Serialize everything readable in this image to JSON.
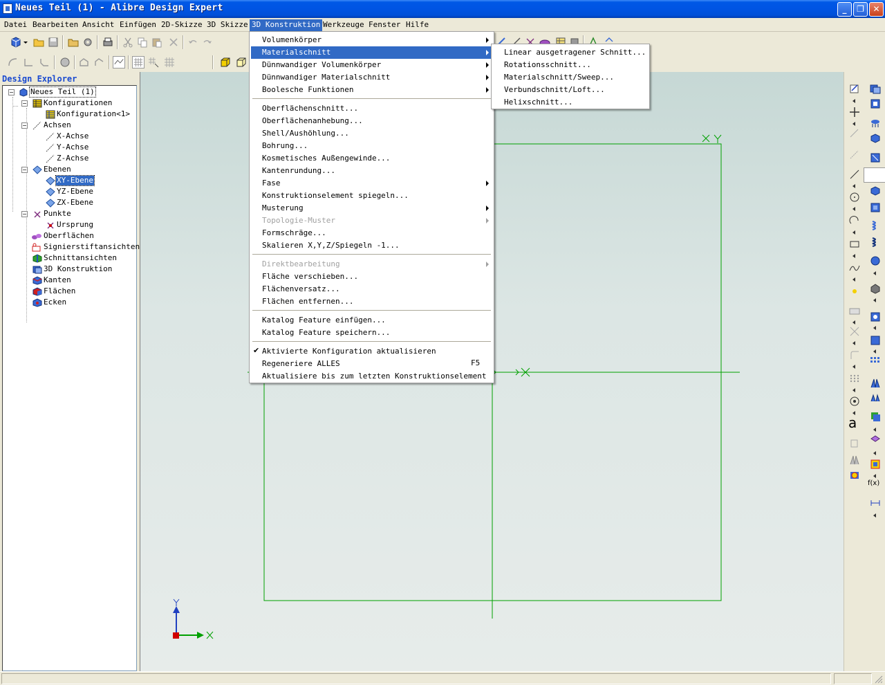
{
  "window": {
    "title": "Neues Teil (1) - Alibre Design Expert",
    "minimize_glyph": "_",
    "maximize_glyph": "❐",
    "close_glyph": "✕"
  },
  "menubar": {
    "items": [
      {
        "label": "Datei"
      },
      {
        "label": "Bearbeiten"
      },
      {
        "label": "Ansicht"
      },
      {
        "label": "Einfügen"
      },
      {
        "label": "2D-Skizze"
      },
      {
        "label": "3D Skizze"
      },
      {
        "label": "3D Konstruktion",
        "active": true
      },
      {
        "label": "Werkzeuge"
      },
      {
        "label": "Fenster"
      },
      {
        "label": "Hilfe"
      }
    ]
  },
  "explorer": {
    "title": "Design Explorer",
    "tree": [
      {
        "label": "Neues Teil (1)",
        "icon": "part-icon"
      },
      {
        "label": "Konfigurationen",
        "icon": "configurations-icon"
      },
      {
        "label": "Konfiguration<1>",
        "icon": "configuration-table-icon"
      },
      {
        "label": "Achsen",
        "icon": "axes-icon"
      },
      {
        "label": "X-Achse",
        "icon": "axis-icon"
      },
      {
        "label": "Y-Achse",
        "icon": "axis-icon"
      },
      {
        "label": "Z-Achse",
        "icon": "axis-icon"
      },
      {
        "label": "Ebenen",
        "icon": "planes-icon"
      },
      {
        "label": "XY-Ebene",
        "icon": "plane-icon",
        "selected": true
      },
      {
        "label": "YZ-Ebene",
        "icon": "plane-icon"
      },
      {
        "label": "ZX-Ebene",
        "icon": "plane-icon"
      },
      {
        "label": "Punkte",
        "icon": "points-icon"
      },
      {
        "label": "Ursprung",
        "icon": "origin-icon"
      },
      {
        "label": "Oberflächen",
        "icon": "surfaces-icon"
      },
      {
        "label": "Signierstiftansichten",
        "icon": "redline-views-icon"
      },
      {
        "label": "Schnittansichten",
        "icon": "section-views-icon"
      },
      {
        "label": "3D Konstruktion",
        "icon": "3d-construction-icon"
      },
      {
        "label": "Kanten",
        "icon": "edges-icon"
      },
      {
        "label": "Flächen",
        "icon": "faces-icon"
      },
      {
        "label": "Ecken",
        "icon": "vertices-icon"
      }
    ]
  },
  "konstruktion_menu": {
    "items": [
      {
        "label": "Volumenkörper",
        "submenu": true
      },
      {
        "label": "Materialschnitt",
        "submenu": true,
        "highlighted": true
      },
      {
        "label": "Dünnwandiger Volumenkörper",
        "submenu": true
      },
      {
        "label": "Dünnwandiger Materialschnitt",
        "submenu": true
      },
      {
        "label": "Boolesche Funktionen",
        "submenu": true
      },
      {
        "separator": true
      },
      {
        "label": "Oberflächenschnitt..."
      },
      {
        "label": "Oberflächenanhebung..."
      },
      {
        "label": "Shell/Aushöhlung..."
      },
      {
        "label": "Bohrung..."
      },
      {
        "label": "Kosmetisches Außengewinde..."
      },
      {
        "label": "Kantenrundung..."
      },
      {
        "label": "Fase",
        "submenu": true
      },
      {
        "label": "Konstruktionselement spiegeln..."
      },
      {
        "label": "Musterung",
        "submenu": true
      },
      {
        "label": "Topologie-Muster",
        "submenu": true,
        "disabled": true
      },
      {
        "label": "Formschräge..."
      },
      {
        "label": "Skalieren X,Y,Z/Spiegeln -1..."
      },
      {
        "separator": true
      },
      {
        "label": "Direktbearbeitung",
        "submenu": true,
        "disabled": true
      },
      {
        "label": "Fläche verschieben..."
      },
      {
        "label": "Flächenversatz..."
      },
      {
        "label": "Flächen entfernen..."
      },
      {
        "separator": true
      },
      {
        "label": "Katalog Feature einfügen..."
      },
      {
        "label": "Katalog Feature speichern..."
      },
      {
        "separator": true
      },
      {
        "label": "Aktivierte Konfiguration aktualisieren",
        "checked": true
      },
      {
        "label": "Regeneriere ALLES",
        "shortcut": "F5"
      },
      {
        "label": "Aktualisiere bis zum letzten Konstruktionselement"
      }
    ]
  },
  "materialschnitt_submenu": {
    "items": [
      {
        "label": "Linear ausgetragener Schnitt..."
      },
      {
        "label": "Rotationsschnitt..."
      },
      {
        "label": "Materialschnitt/Sweep..."
      },
      {
        "label": "Verbundschnitt/Loft..."
      },
      {
        "label": "Helixschnitt..."
      }
    ]
  },
  "viewport": {
    "axis_labels": {
      "x": "X",
      "y": "Y"
    },
    "sketch_color": "#00a000"
  },
  "right_toolbar": {
    "fx_label": "f(x)",
    "text_tool_label": "a"
  }
}
